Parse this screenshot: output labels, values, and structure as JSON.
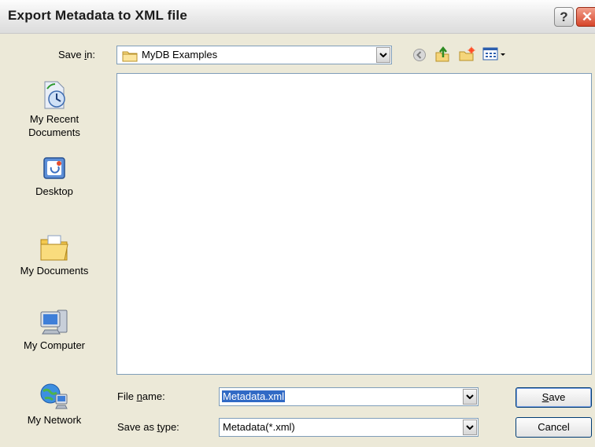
{
  "window": {
    "title": "Export Metadata to XML file",
    "help_glyph": "?",
    "close_glyph": "✕"
  },
  "save_in": {
    "label_pre": "Save ",
    "label_u": "i",
    "label_post": "n:",
    "folder": "MyDB Examples",
    "folder_icon": "folder-icon"
  },
  "toolbar": {
    "icons": [
      "back-icon",
      "up-folder-icon",
      "new-folder-icon",
      "views-menu-icon"
    ]
  },
  "places": [
    {
      "label_1": "My Recent",
      "label_2": "Documents",
      "icon": "recent-documents-icon"
    },
    {
      "label_1": "Desktop",
      "icon": "desktop-icon"
    },
    {
      "label_1": "My Documents",
      "icon": "my-documents-icon"
    },
    {
      "label_1": "My Computer",
      "icon": "my-computer-icon"
    },
    {
      "label_1": "My Network",
      "icon": "my-network-icon"
    }
  ],
  "file_name": {
    "label_pre": "File ",
    "label_u": "n",
    "label_post": "ame:",
    "value": "Metadata.xml"
  },
  "save_type": {
    "label_pre": "Save as ",
    "label_u": "t",
    "label_post": "ype:",
    "value": "Metadata(*.xml)"
  },
  "buttons": {
    "save_u": "S",
    "save_rest": "ave",
    "cancel": "Cancel"
  },
  "colors": {
    "accent": "#316ac5",
    "border": "#7f9db9"
  }
}
